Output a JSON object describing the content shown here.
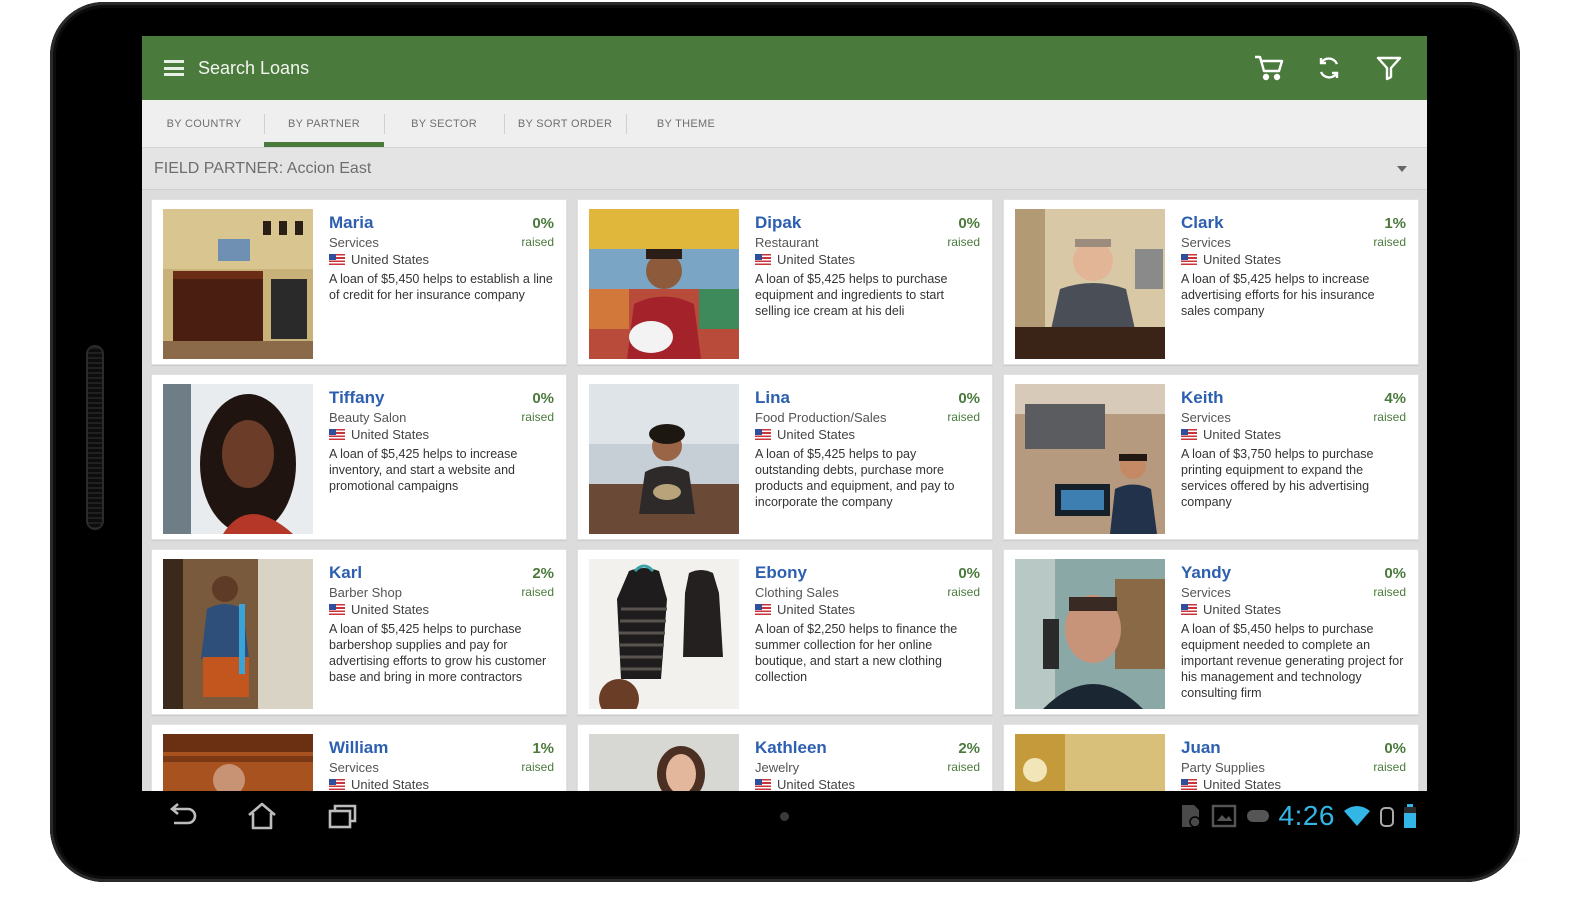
{
  "app": {
    "title": "Search Loans",
    "accent_color": "#4b7a3d",
    "link_color": "#2d5fb0"
  },
  "appbar_icons": [
    "menu-icon",
    "cart-icon",
    "refresh-icon",
    "filter-icon"
  ],
  "tabs": [
    {
      "label": "BY COUNTRY"
    },
    {
      "label": "BY PARTNER",
      "active": true
    },
    {
      "label": "BY SECTOR"
    },
    {
      "label": "BY SORT ORDER"
    },
    {
      "label": "BY THEME"
    }
  ],
  "filter": {
    "label": "FIELD PARTNER: Accion East"
  },
  "loans": [
    {
      "name": "Maria",
      "percent": "0%",
      "raised_label": "raised",
      "sector": "Services",
      "country": "United States",
      "description": "A loan of $5,450 helps to establish a line of credit for her insurance company"
    },
    {
      "name": "Dipak",
      "percent": "0%",
      "raised_label": "raised",
      "sector": "Restaurant",
      "country": "United States",
      "description": "A loan of $5,425 helps to purchase equipment and ingredients to start selling ice cream at his deli"
    },
    {
      "name": "Clark",
      "percent": "1%",
      "raised_label": "raised",
      "sector": "Services",
      "country": "United States",
      "description": "A loan of $5,425 helps to increase advertising efforts for his insurance sales company"
    },
    {
      "name": "Tiffany",
      "percent": "0%",
      "raised_label": "raised",
      "sector": "Beauty Salon",
      "country": "United States",
      "description": "A loan of $5,425 helps to increase inventory, and start a website and promotional campaigns"
    },
    {
      "name": "Lina",
      "percent": "0%",
      "raised_label": "raised",
      "sector": "Food Production/Sales",
      "country": "United States",
      "description": "A loan of $5,425 helps to pay outstanding debts, purchase more products and equipment, and pay to incorporate the company"
    },
    {
      "name": "Keith",
      "percent": "4%",
      "raised_label": "raised",
      "sector": "Services",
      "country": "United States",
      "description": "A loan of $3,750 helps to purchase printing equipment to expand the services offered by his advertising company"
    },
    {
      "name": "Karl",
      "percent": "2%",
      "raised_label": "raised",
      "sector": "Barber Shop",
      "country": "United States",
      "description": "A loan of $5,425 helps to purchase barbershop supplies and pay for advertising efforts to grow his customer base and bring in more contractors"
    },
    {
      "name": "Ebony",
      "percent": "0%",
      "raised_label": "raised",
      "sector": "Clothing Sales",
      "country": "United States",
      "description": "A loan of $2,250 helps to finance the summer collection for her online boutique, and start a new clothing collection"
    },
    {
      "name": "Yandy",
      "percent": "0%",
      "raised_label": "raised",
      "sector": "Services",
      "country": "United States",
      "description": "A loan of $5,450 helps to purchase equipment needed to complete an important revenue generating project for his management and technology consulting firm"
    },
    {
      "name": "William",
      "percent": "1%",
      "raised_label": "raised",
      "sector": "Services",
      "country": "United States",
      "description": ""
    },
    {
      "name": "Kathleen",
      "percent": "2%",
      "raised_label": "raised",
      "sector": "Jewelry",
      "country": "United States",
      "description": ""
    },
    {
      "name": "Juan",
      "percent": "0%",
      "raised_label": "raised",
      "sector": "Party Supplies",
      "country": "United States",
      "description": ""
    }
  ],
  "system": {
    "time": "4:26"
  }
}
